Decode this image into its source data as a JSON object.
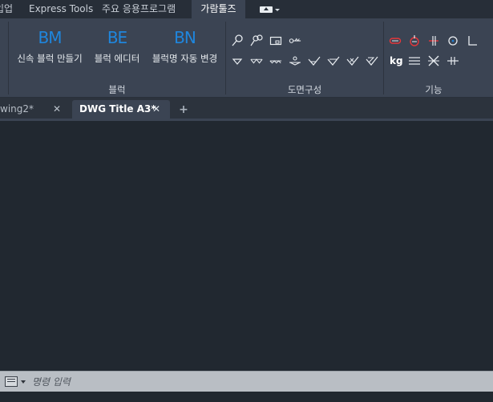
{
  "ribbon_tabs": [
    {
      "label": "입업"
    },
    {
      "label": "Express Tools"
    },
    {
      "label": "주요 응용프로그램"
    },
    {
      "label": "가람툴즈"
    }
  ],
  "ribbon": {
    "block_panel": {
      "title": "블럭",
      "buttons": [
        {
          "icon_text": "BM",
          "label": "신속 블럭 만들기"
        },
        {
          "icon_text": "BE",
          "label": "블럭 에디터"
        },
        {
          "icon_text": "BN",
          "label": "블럭명 자동 변경"
        }
      ]
    },
    "drawing_panel": {
      "title": "도면구성"
    },
    "function_panel": {
      "title": "기능",
      "kg_label": "kg"
    },
    "colors": {
      "accent": "#1f86dd",
      "marker_red": "#e8363a",
      "panel_bg": "#3b4453"
    }
  },
  "doc_tabs": [
    {
      "label": "wing2*",
      "close": "✕"
    },
    {
      "label": "DWG Title A3*",
      "close": "✕"
    }
  ],
  "new_tab": "+",
  "command_line": {
    "placeholder": "명령 입력"
  }
}
